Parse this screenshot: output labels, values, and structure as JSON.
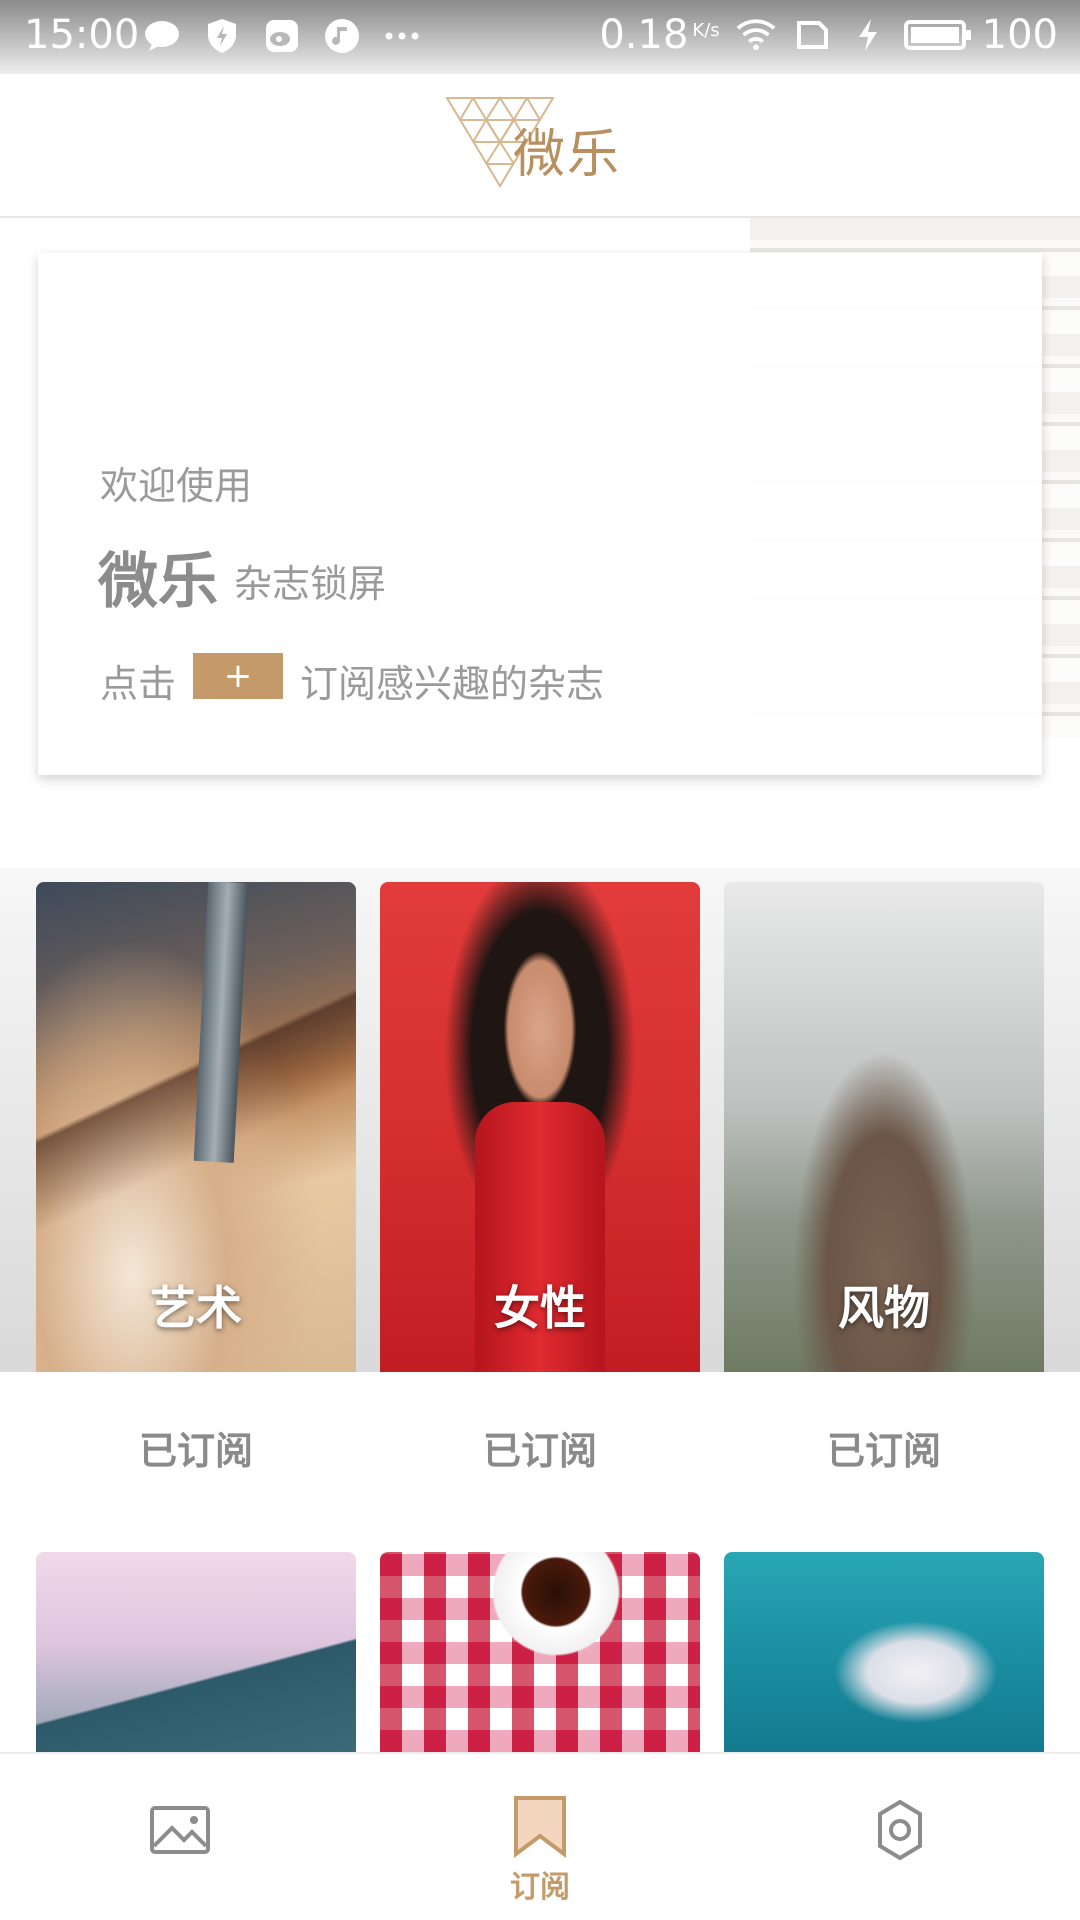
{
  "status_bar": {
    "time": "15:00",
    "speed": "0.18",
    "speed_unit": "K/s",
    "battery": "100",
    "battery_level": 100,
    "icons": [
      "chat-icon",
      "shield-icon",
      "weibo-icon",
      "music-icon",
      "more-icon",
      "wifi-icon",
      "no-sim-icon",
      "charging-icon",
      "battery-icon"
    ]
  },
  "header": {
    "logo_text": "微乐"
  },
  "welcome": {
    "line1": "欢迎使用",
    "brand": "微乐",
    "subtitle": "杂志锁屏",
    "tip_prefix": "点击",
    "tip_plus": "+",
    "tip_suffix": "订阅感兴趣的杂志"
  },
  "magazines": [
    {
      "label": "艺术",
      "status": "已订阅"
    },
    {
      "label": "女性",
      "status": "已订阅"
    },
    {
      "label": "风物",
      "status": "已订阅"
    }
  ],
  "bottom_nav": {
    "items": [
      {
        "icon": "image-icon",
        "label": ""
      },
      {
        "icon": "bookmark-icon",
        "label": "订阅",
        "active": true
      },
      {
        "icon": "settings-icon",
        "label": ""
      }
    ]
  },
  "colors": {
    "accent": "#c49a6a",
    "text_muted": "#9a9a9a",
    "icon_inactive": "#8c8c8c"
  }
}
